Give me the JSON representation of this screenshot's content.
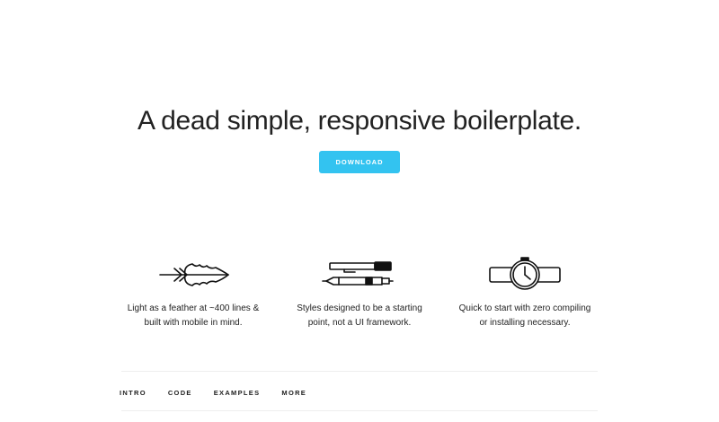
{
  "hero": {
    "title": "A dead simple, responsive boilerplate.",
    "download_label": "DOWNLOAD"
  },
  "colors": {
    "accent": "#33c3f0",
    "text": "#222222",
    "divider": "#eeeeee"
  },
  "features": [
    {
      "icon": "feather-icon",
      "line1": "Light as a feather at ~400 lines &",
      "line2": "built with mobile in mind."
    },
    {
      "icon": "pens-icon",
      "line1": "Styles designed to be a starting",
      "line2": "point, not a UI framework."
    },
    {
      "icon": "watch-icon",
      "line1": "Quick to start with zero compiling",
      "line2": "or installing necessary."
    }
  ],
  "nav": {
    "items": [
      "INTRO",
      "CODE",
      "EXAMPLES",
      "MORE"
    ]
  }
}
